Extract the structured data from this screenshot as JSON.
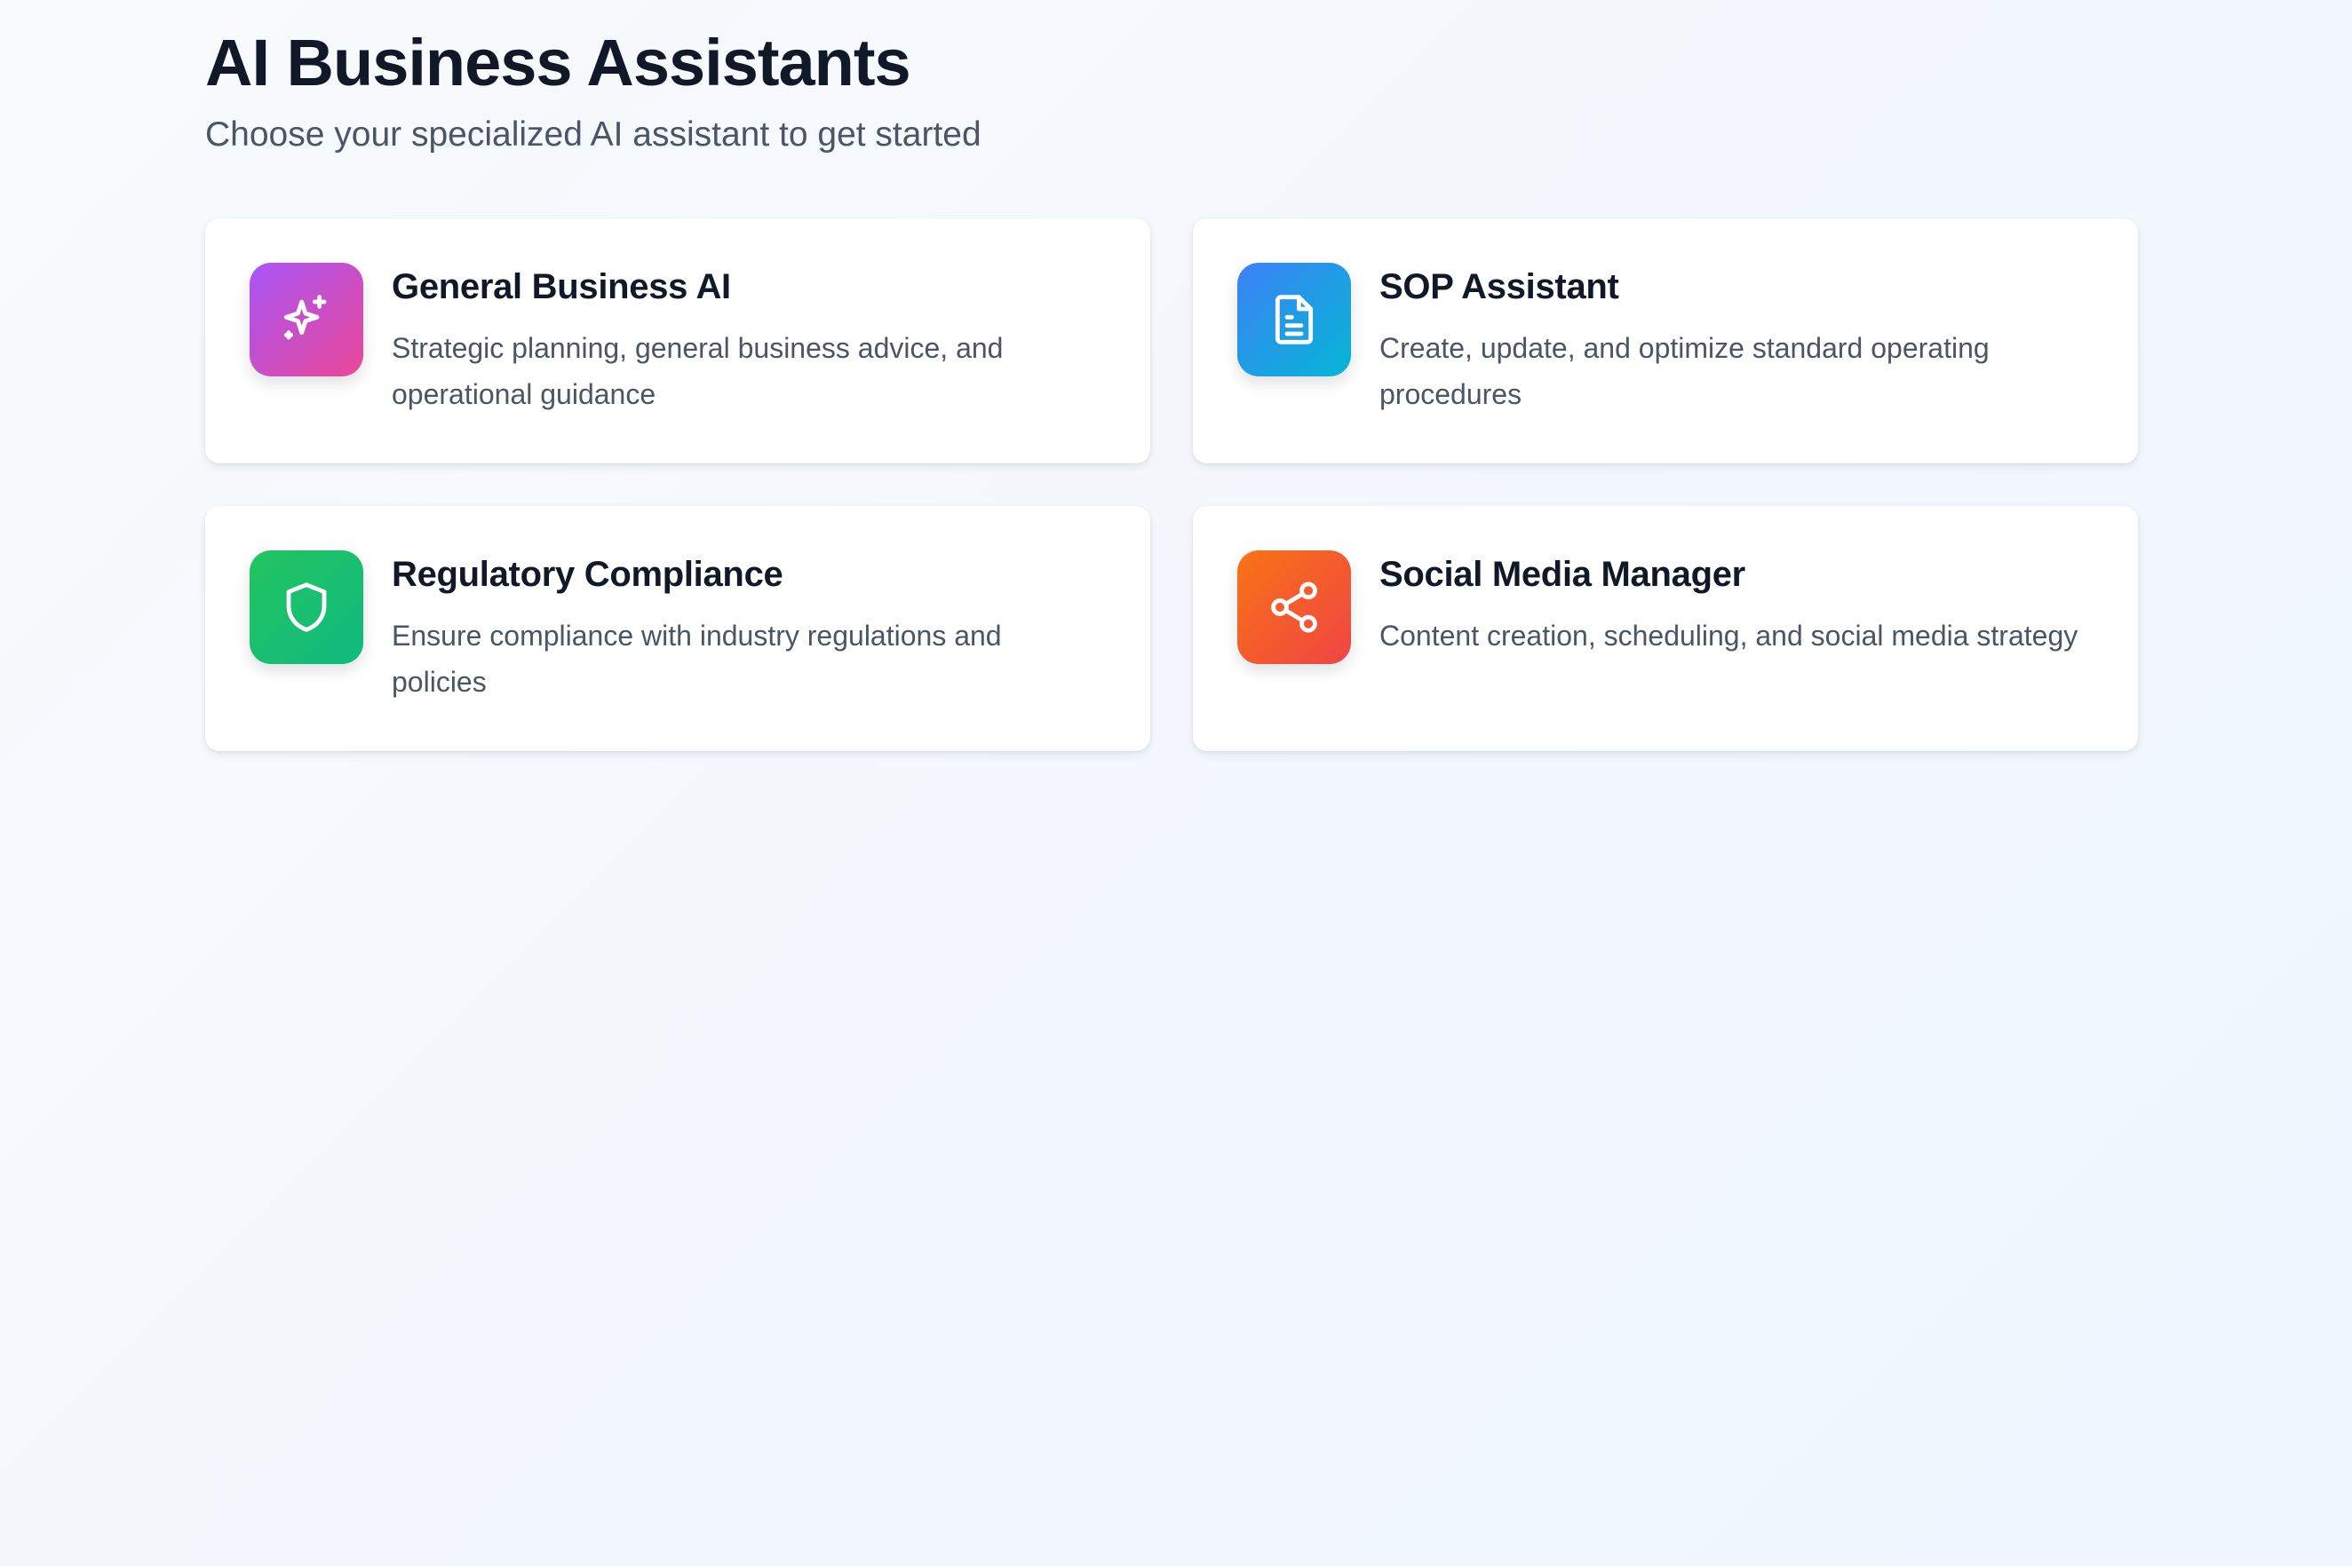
{
  "header": {
    "title": "AI Business Assistants",
    "subtitle": "Choose your specialized AI assistant to get started"
  },
  "assistants": [
    {
      "title": "General Business AI",
      "description": "Strategic planning, general business advice, and operational guidance",
      "icon": "sparkles-icon",
      "gradient": [
        "#a855f7",
        "#ec4899"
      ]
    },
    {
      "title": "SOP Assistant",
      "description": "Create, update, and optimize standard operating procedures",
      "icon": "document-icon",
      "gradient": [
        "#3b82f6",
        "#06b6d4"
      ]
    },
    {
      "title": "Regulatory Compliance",
      "description": "Ensure compliance with industry regulations and policies",
      "icon": "shield-icon",
      "gradient": [
        "#22c55e",
        "#10b981"
      ]
    },
    {
      "title": "Social Media Manager",
      "description": "Content creation, scheduling, and social media strategy",
      "icon": "share-icon",
      "gradient": [
        "#f97316",
        "#ef4444"
      ]
    }
  ]
}
